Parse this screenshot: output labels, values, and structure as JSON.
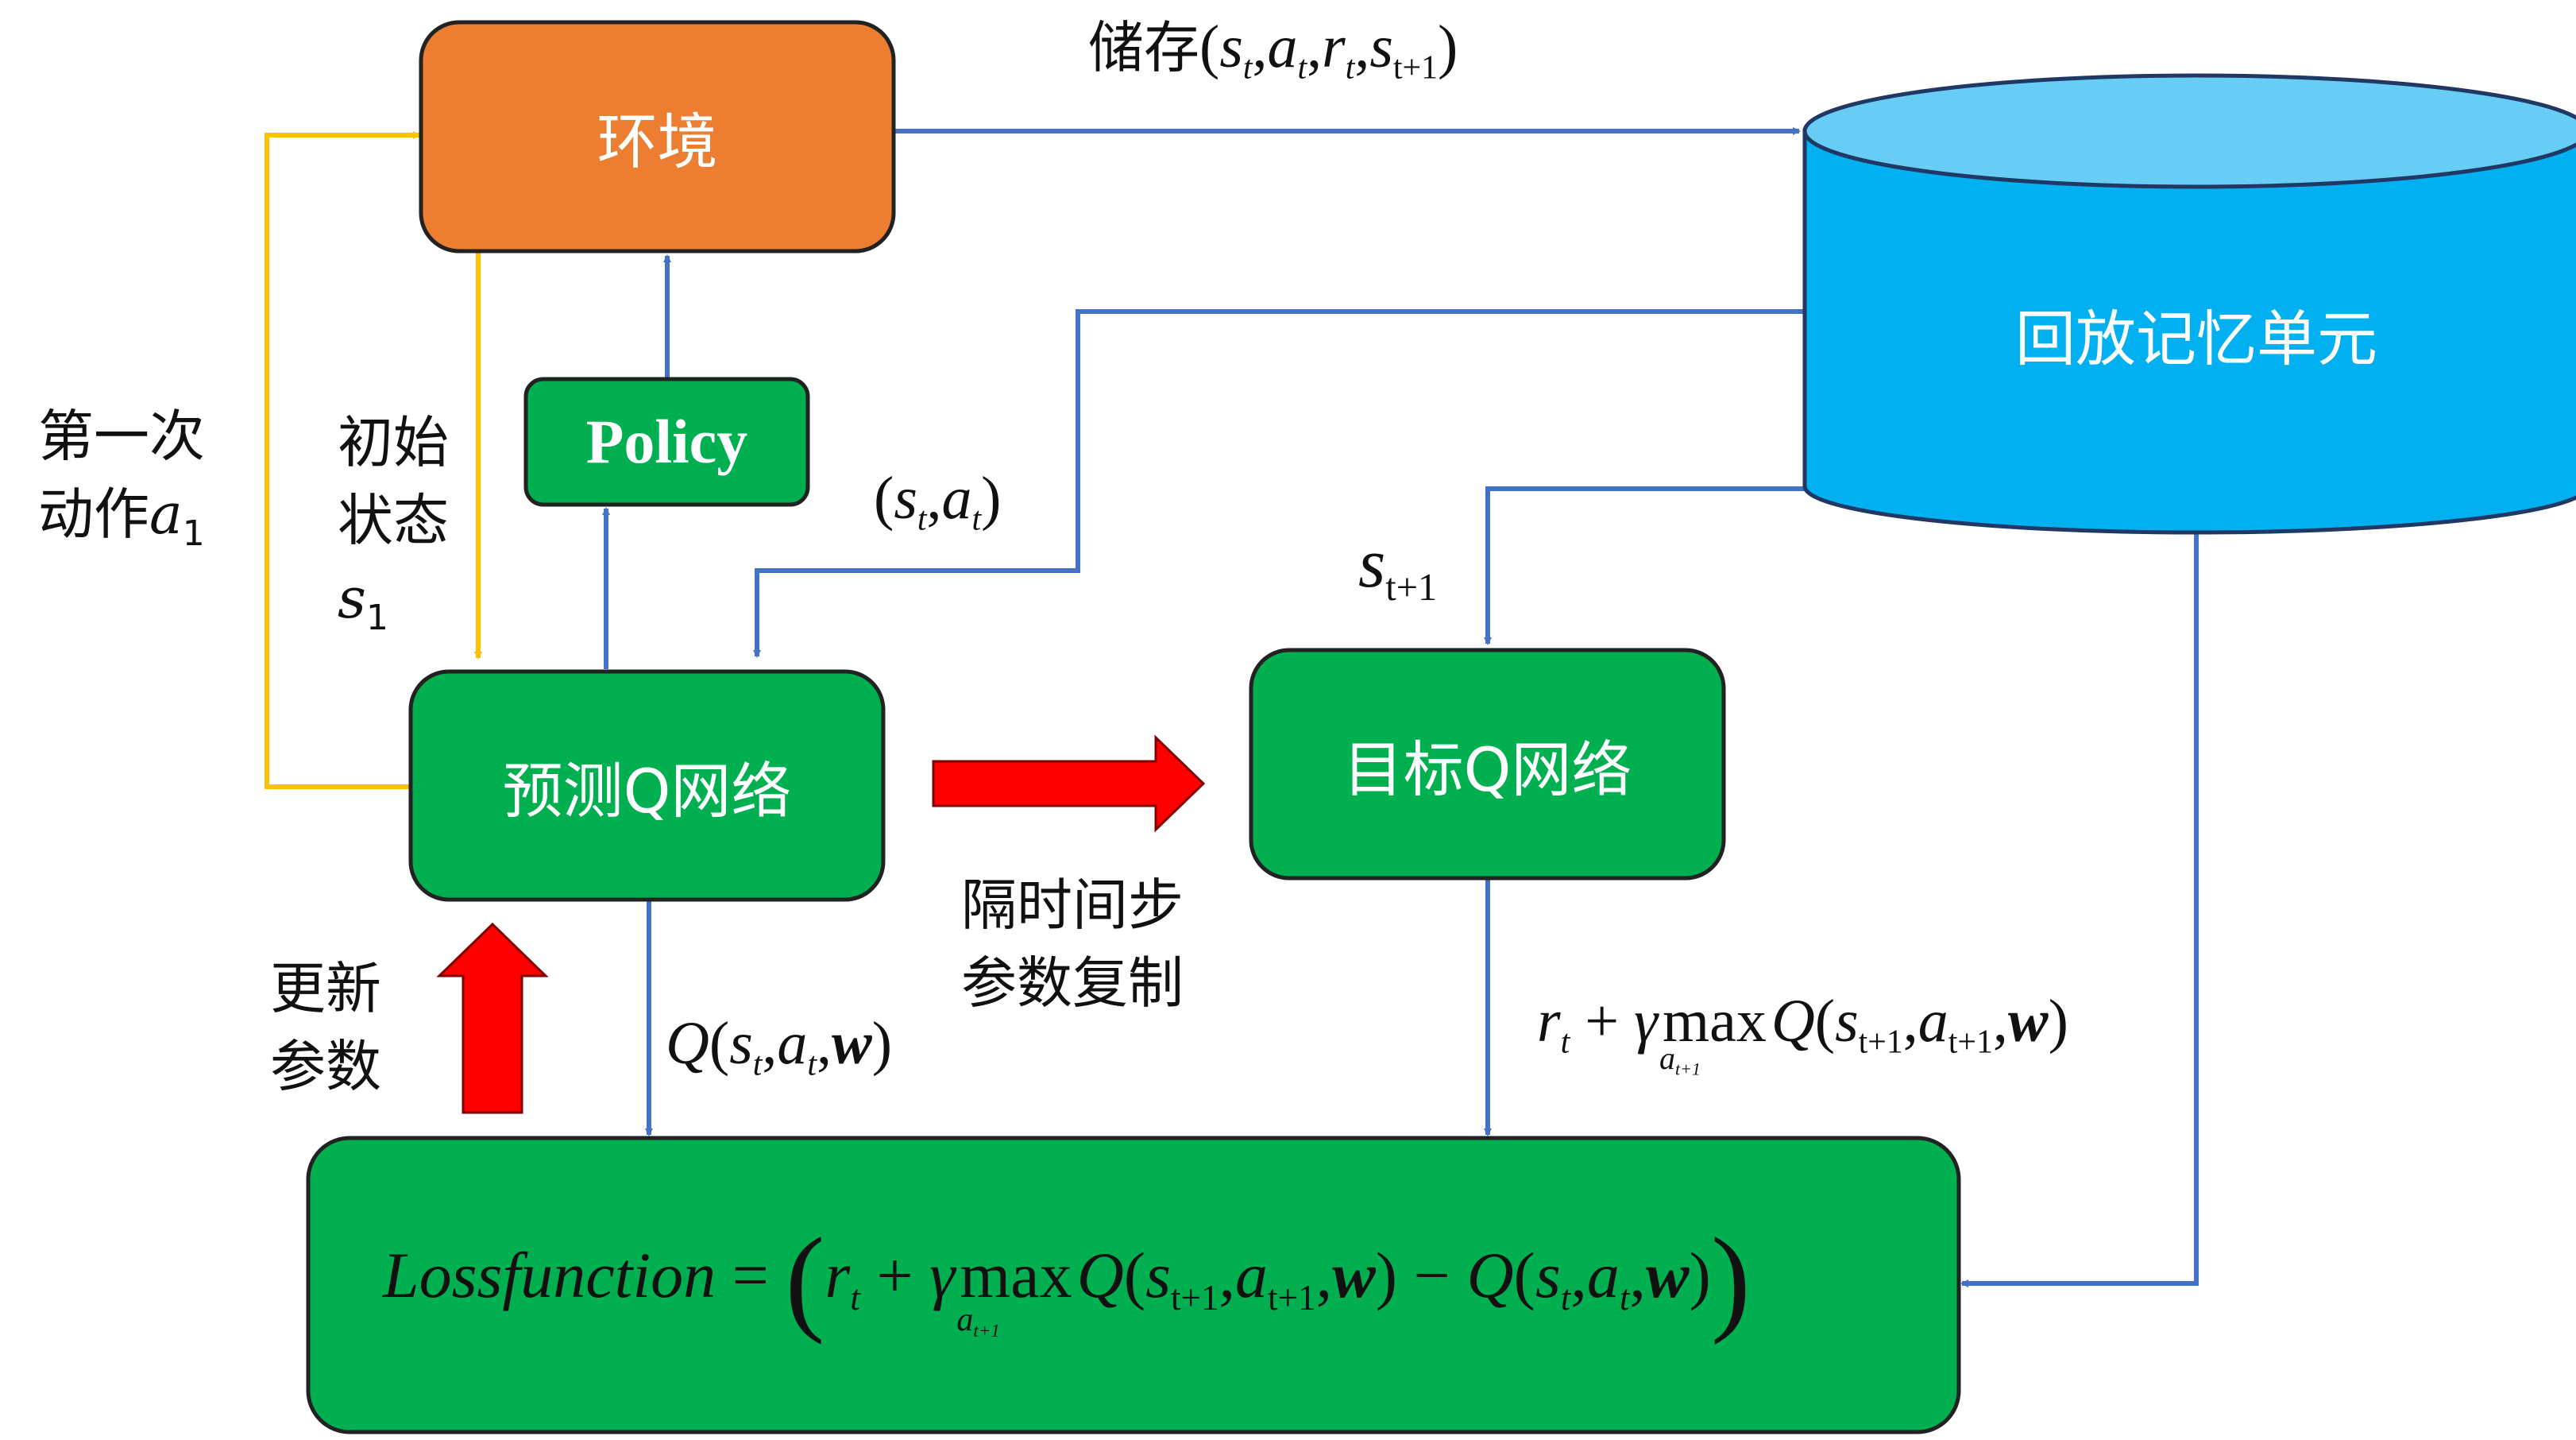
{
  "nodes": {
    "environment": "环境",
    "policy": "Policy",
    "replay_memory": "回放记忆单元",
    "predict_net": "预测Q网络",
    "target_net": "目标Q网络"
  },
  "labels": {
    "store_prefix": "储存",
    "store_tuple": [
      "s",
      "t",
      "a",
      "t",
      "r",
      "t",
      "s",
      "t+1"
    ],
    "first_action": [
      "第一次",
      "动作"
    ],
    "first_action_var": [
      "a",
      "1"
    ],
    "initial_state": [
      "初始",
      "状态"
    ],
    "initial_state_var": [
      "s",
      "1"
    ],
    "state_action": [
      "s",
      "t",
      "a",
      "t"
    ],
    "next_state": [
      "s",
      "t+1"
    ],
    "copy_params": [
      "隔时间步",
      "参数复制"
    ],
    "update_params": [
      "更新",
      "参数"
    ],
    "q_pred": [
      "Q",
      "s",
      "t",
      "a",
      "t",
      "w"
    ],
    "q_target": [
      "r",
      "t",
      "γ",
      "max",
      "a",
      "t+1",
      "Q",
      "s",
      "t+1",
      "a",
      "t+1",
      "w"
    ],
    "loss": [
      "Lossfunction",
      "r",
      "t",
      "γ",
      "max",
      "a",
      "t+1",
      "Q",
      "s",
      "t+1",
      "a",
      "t+1",
      "w",
      "Q",
      "s",
      "t",
      "a",
      "t",
      "w"
    ]
  },
  "colors": {
    "green": "#00B050",
    "orange": "#ED7D31",
    "blue_db": "#00B0F0",
    "arrow_blue": "#4472C4",
    "arrow_yellow": "#FFC000",
    "arrow_red": "#FF0000"
  }
}
